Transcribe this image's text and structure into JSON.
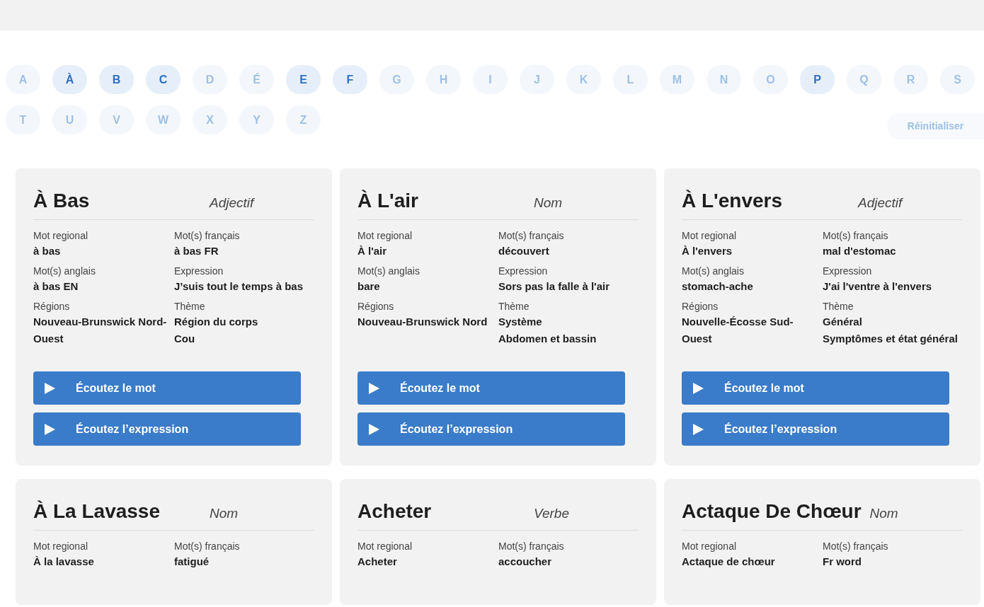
{
  "letters": [
    {
      "label": "A",
      "disabled": true
    },
    {
      "label": "À",
      "disabled": false
    },
    {
      "label": "B",
      "disabled": false
    },
    {
      "label": "C",
      "disabled": false
    },
    {
      "label": "D",
      "disabled": true
    },
    {
      "label": "É",
      "disabled": true
    },
    {
      "label": "E",
      "disabled": false
    },
    {
      "label": "F",
      "disabled": false
    },
    {
      "label": "G",
      "disabled": true
    },
    {
      "label": "H",
      "disabled": true
    },
    {
      "label": "I",
      "disabled": true
    },
    {
      "label": "J",
      "disabled": true
    },
    {
      "label": "K",
      "disabled": true
    },
    {
      "label": "L",
      "disabled": true
    },
    {
      "label": "M",
      "disabled": true
    },
    {
      "label": "N",
      "disabled": true
    },
    {
      "label": "O",
      "disabled": true
    },
    {
      "label": "P",
      "disabled": false
    },
    {
      "label": "Q",
      "disabled": true
    },
    {
      "label": "R",
      "disabled": true
    },
    {
      "label": "S",
      "disabled": true
    },
    {
      "label": "T",
      "disabled": true
    },
    {
      "label": "U",
      "disabled": true
    },
    {
      "label": "V",
      "disabled": true
    },
    {
      "label": "W",
      "disabled": true
    },
    {
      "label": "X",
      "disabled": true
    },
    {
      "label": "Y",
      "disabled": true
    },
    {
      "label": "Z",
      "disabled": true
    }
  ],
  "reset_button": {
    "label": "Réinitialiser",
    "disabled": true
  },
  "cards": [
    {
      "title": "À Bas",
      "type": "Adjectif",
      "fields": [
        {
          "label": "Mot regional",
          "values": [
            "à bas"
          ]
        },
        {
          "label": "Mot(s) français",
          "values": [
            "à bas FR"
          ]
        },
        {
          "label": "Mot(s) anglais",
          "values": [
            "à bas EN"
          ]
        },
        {
          "label": "Expression",
          "values": [
            "J’suis tout le temps à bas"
          ]
        },
        {
          "label": "Régions",
          "values": [
            "Nouveau-Brunswick Nord-Ouest"
          ]
        },
        {
          "label": "Thème",
          "values": [
            "Région du corps",
            "Cou"
          ]
        }
      ],
      "buttons": [
        "Écoutez le mot",
        "Écoutez l’expression"
      ]
    },
    {
      "title": "À L'air",
      "type": "Nom",
      "fields": [
        {
          "label": "Mot regional",
          "values": [
            "À l'air"
          ]
        },
        {
          "label": "Mot(s) français",
          "values": [
            "découvert"
          ]
        },
        {
          "label": "Mot(s) anglais",
          "values": [
            "bare"
          ]
        },
        {
          "label": "Expression",
          "values": [
            "Sors pas la falle à l'air"
          ]
        },
        {
          "label": "Régions",
          "values": [
            "Nouveau-Brunswick Nord"
          ]
        },
        {
          "label": "Thème",
          "values": [
            "Système",
            "Abdomen et bassin"
          ]
        }
      ],
      "buttons": [
        "Écoutez le mot",
        "Écoutez l’expression"
      ]
    },
    {
      "title": "À L'envers",
      "type": "Adjectif",
      "fields": [
        {
          "label": "Mot regional",
          "values": [
            "À l'envers"
          ]
        },
        {
          "label": "Mot(s) français",
          "values": [
            "mal d'estomac"
          ]
        },
        {
          "label": "Mot(s) anglais",
          "values": [
            "stomach-ache"
          ]
        },
        {
          "label": "Expression",
          "values": [
            "J'ai l'ventre à l'envers"
          ]
        },
        {
          "label": "Régions",
          "values": [
            "Nouvelle-Écosse Sud-Ouest"
          ]
        },
        {
          "label": "Thème",
          "values": [
            "Général",
            "Symptômes et état général"
          ]
        }
      ],
      "buttons": [
        "Écoutez le mot",
        "Écoutez l’expression"
      ]
    },
    {
      "title": "À La Lavasse",
      "type": "Nom",
      "fields": [
        {
          "label": "Mot regional",
          "values": [
            "À la lavasse"
          ]
        },
        {
          "label": "Mot(s) français",
          "values": [
            "fatigué"
          ]
        }
      ]
    },
    {
      "title": "Acheter",
      "type": "Verbe",
      "fields": [
        {
          "label": "Mot regional",
          "values": [
            "Acheter"
          ]
        },
        {
          "label": "Mot(s) français",
          "values": [
            "accoucher"
          ]
        }
      ]
    },
    {
      "title": "Actaque De Chœur",
      "type": "Nom",
      "fields": [
        {
          "label": "Mot regional",
          "values": [
            "Actaque de chœur"
          ]
        },
        {
          "label": "Mot(s) français",
          "values": [
            "Fr word"
          ]
        }
      ]
    }
  ]
}
